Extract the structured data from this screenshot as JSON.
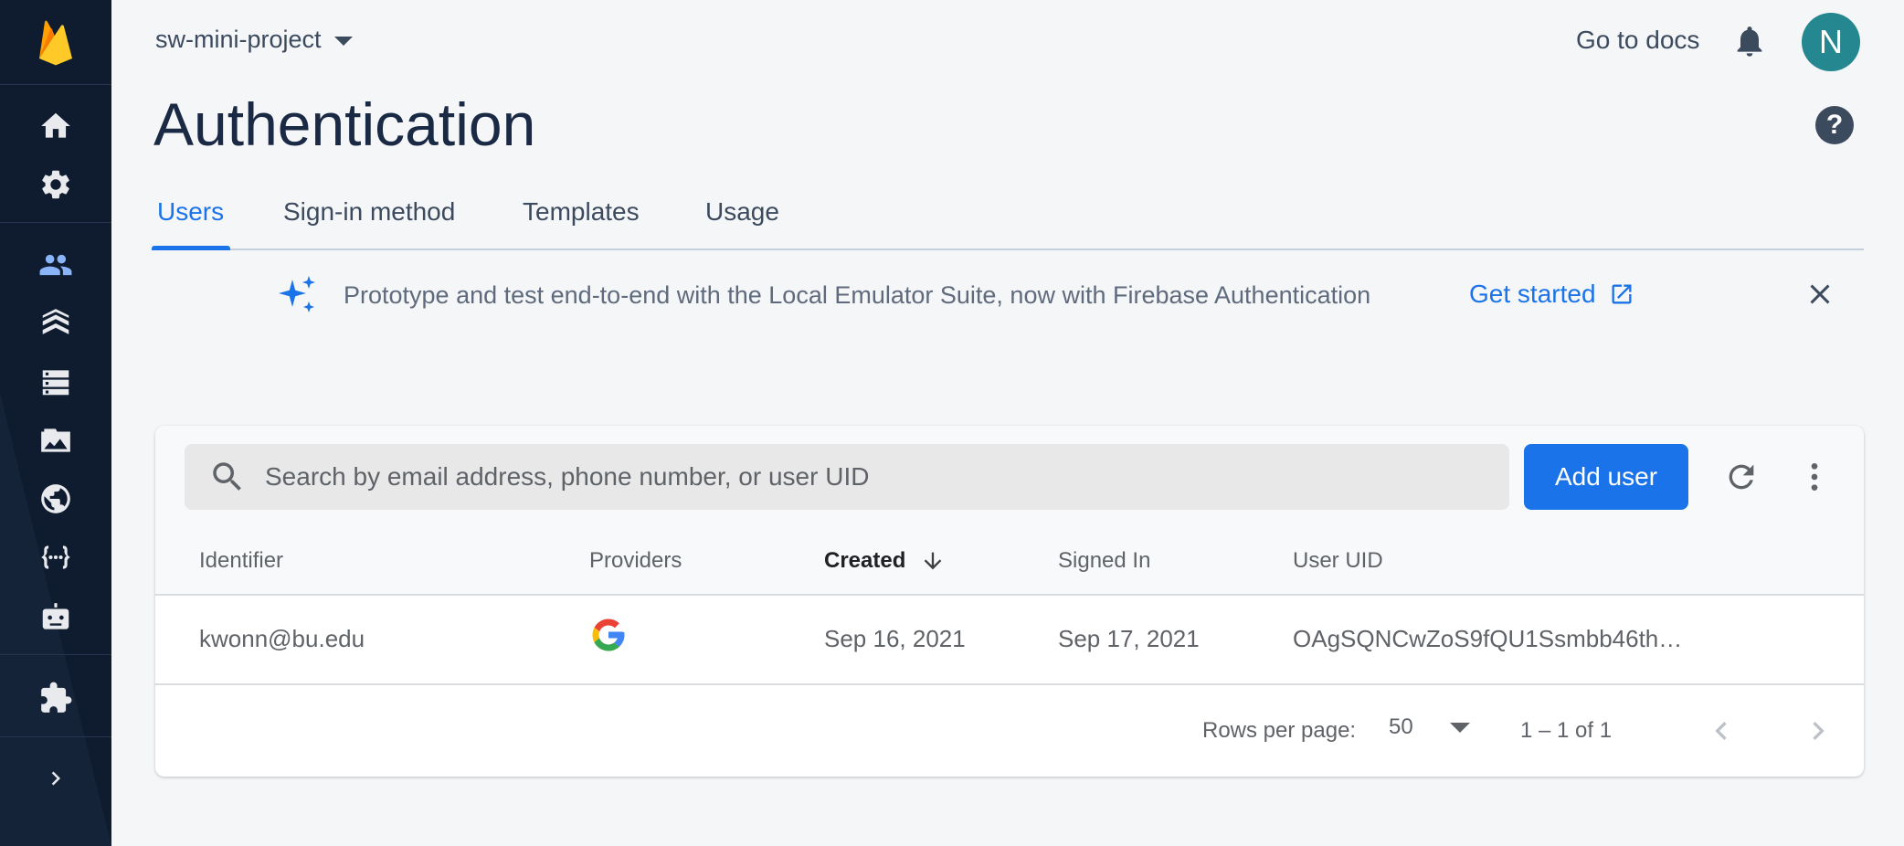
{
  "sidebar": {
    "logo": "firebase-logo",
    "items": [
      {
        "name": "home",
        "icon": "home-icon"
      },
      {
        "name": "settings",
        "icon": "gear-icon"
      },
      {
        "name": "authentication",
        "icon": "people-icon",
        "active": true
      },
      {
        "name": "firestore",
        "icon": "firestore-icon"
      },
      {
        "name": "database",
        "icon": "database-icon"
      },
      {
        "name": "storage",
        "icon": "image-icon"
      },
      {
        "name": "hosting",
        "icon": "globe-icon"
      },
      {
        "name": "functions",
        "icon": "functions-icon"
      },
      {
        "name": "ml",
        "icon": "robot-icon"
      },
      {
        "name": "extensions",
        "icon": "puzzle-icon"
      },
      {
        "name": "expand",
        "icon": "chevron-right-icon"
      }
    ]
  },
  "header": {
    "project_name": "sw-mini-project",
    "docs_link": "Go to docs",
    "avatar_initial": "N",
    "avatar_color": "#25878f"
  },
  "page": {
    "title": "Authentication",
    "help": "?"
  },
  "tabs": [
    {
      "label": "Users",
      "active": true
    },
    {
      "label": "Sign-in method"
    },
    {
      "label": "Templates"
    },
    {
      "label": "Usage"
    }
  ],
  "banner": {
    "text": "Prototype and test end-to-end with the Local Emulator Suite, now with Firebase Authentication",
    "cta": "Get started"
  },
  "users_table": {
    "search_placeholder": "Search by email address, phone number, or user UID",
    "add_user_label": "Add user",
    "columns": {
      "identifier": "Identifier",
      "providers": "Providers",
      "created": "Created",
      "signed_in": "Signed In",
      "user_uid": "User UID"
    },
    "sort_column": "Created",
    "rows": [
      {
        "identifier": "kwonn@bu.edu",
        "provider": "google-icon",
        "created": "Sep 16, 2021",
        "signed_in": "Sep 17, 2021",
        "user_uid": "OAgSQNCwZoS9fQU1Ssmbb46th…"
      }
    ],
    "footer": {
      "rows_per_page_label": "Rows per page:",
      "rows_per_page_value": "50",
      "range": "1 – 1 of 1"
    }
  },
  "colors": {
    "accent": "#1a73e8",
    "sidebar_bg": "#0f1c30",
    "page_bg": "#f5f6f8"
  }
}
